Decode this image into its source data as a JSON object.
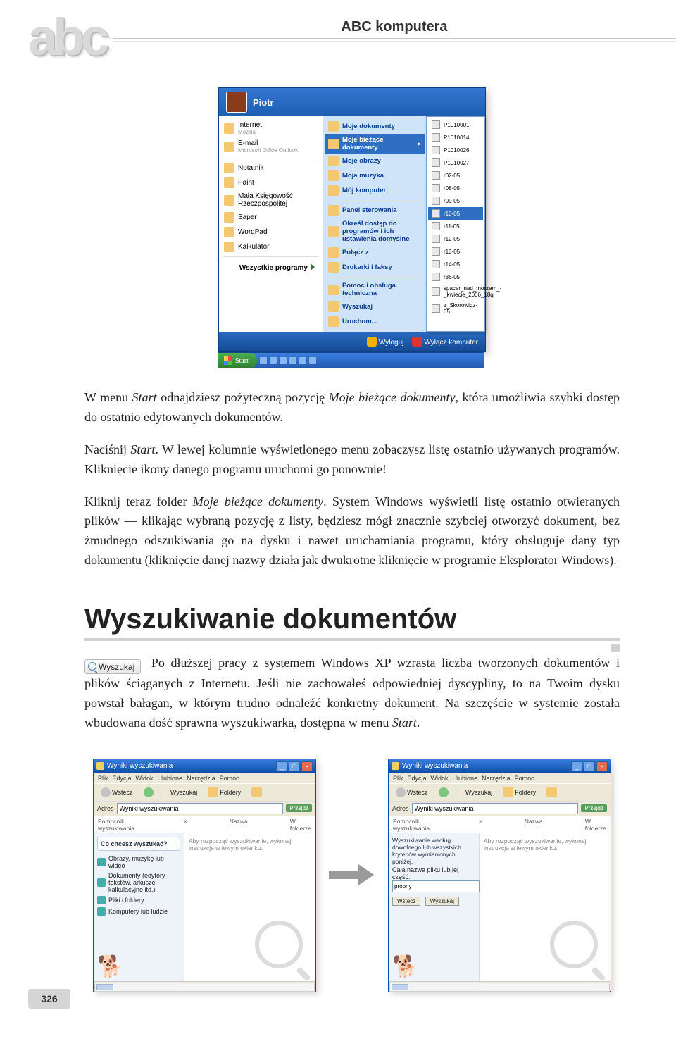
{
  "header": {
    "book_title": "ABC komputera",
    "logo_text": "abc"
  },
  "startmenu": {
    "user": "Piotr",
    "left": [
      {
        "name": "Internet",
        "sub": "Mozilla"
      },
      {
        "name": "E-mail",
        "sub": "Microsoft Office Outlook"
      },
      {
        "name": "Notatnik"
      },
      {
        "name": "Paint"
      },
      {
        "name": "Mała Księgowość Rzeczpospolitej"
      },
      {
        "name": "Saper"
      },
      {
        "name": "WordPad"
      },
      {
        "name": "Kalkulator"
      }
    ],
    "all_programs": "Wszystkie programy",
    "right": [
      "Moje dokumenty",
      "Moje bieżące dokumenty",
      "Moje obrazy",
      "Moja muzyka",
      "Mój komputer",
      "Panel sterowania",
      "Określ dostęp do programów i ich ustawienia domyślne",
      "Połącz z",
      "Drukarki i faksy",
      "Pomoc i obsługa techniczna",
      "Wyszukaj",
      "Uruchom..."
    ],
    "right_highlight_index": 1,
    "submenu": [
      "P1010001",
      "P1010014",
      "P1010026",
      "P1010027",
      "r02-05",
      "r08-05",
      "r09-05",
      "r10-05",
      "r11-05",
      "r12-05",
      "r13-05",
      "r14-05",
      "r36-05",
      "spacer_nad_morzem_-_kwiecie_2006_18q",
      "z_Skorowidz-05"
    ],
    "logoff": "Wyloguj",
    "shutdown": "Wyłącz komputer",
    "start_label": "Start"
  },
  "para1_a": "W menu ",
  "para1_b": "Start",
  "para1_c": " odnajdziesz pożyteczną pozycję ",
  "para1_d": "Moje bieżące dokumenty",
  "para1_e": ", która umożliwia szybki dostęp do ostatnio edytowanych dokumentów.",
  "para2_a": "Naciśnij ",
  "para2_b": "Start",
  "para2_c": ". W lewej kolumnie wyświetlonego menu zobaczysz listę ostatnio używanych programów. Kliknięcie ikony danego programu uruchomi go ponownie!",
  "para3_a": "Kliknij teraz folder ",
  "para3_b": "Moje bieżące dokumenty",
  "para3_c": ". System Windows wyświetli listę ostatnio otwieranych plików — klikając wybraną pozycję z listy, będziesz mógł znacznie szybciej otworzyć dokument, bez żmudnego odszukiwania go na dysku i nawet uruchamiania programu, który obsługuje dany typ dokumentu (kliknięcie danej nazwy działa jak dwukrotne kliknięcie w programie Eksplorator Windows).",
  "section_title": "Wyszukiwanie dokumentów",
  "search_chip": "Wyszukaj",
  "para4_a": " Po dłuższej pracy z systemem Windows XP wzrasta liczba tworzonych dokumentów i plików ściąganych z Internetu. Jeśli nie zachowałeś odpowiedniej dyscypliny, to na Twoim dysku powstał bałagan, w którym trudno odnaleźć konkretny dokument. Na szczęście w systemie została wbudowana dość sprawna wyszukiwarka, dostępna w menu ",
  "para4_b": "Start",
  "para4_c": ".",
  "searchwin": {
    "title": "Wyniki wyszukiwania",
    "menu": [
      "Plik",
      "Edycja",
      "Widok",
      "Ulubione",
      "Narzędzia",
      "Pomoc"
    ],
    "toolbar": {
      "back": "Wstecz",
      "search": "Wyszukaj",
      "folders": "Foldery"
    },
    "addr_label": "Adres",
    "addr_value": "Wyniki wyszukiwania",
    "go": "Przejdź",
    "col_name": "Nazwa",
    "col_folder": "W folderze",
    "helper_line1": "Pomocnik wyszukiwania",
    "helper_hint": "Aby rozpocząć wyszukiwanie, wykonaj instrukcje w lewym okienku.",
    "ask": "Co chcesz wyszukać?",
    "opts": [
      "Obrazy, muzykę lub wideo",
      "Dokumenty (edytory tekstów, arkusze kalkulacyjne itd.)",
      "Pliki i foldery",
      "Komputery lub ludzie"
    ],
    "right_ask": "Wyszukiwanie według dowolnego lub wszystkich kryteriów wymienionych poniżej.",
    "field_label": "Cała nazwa pliku lub jej część:",
    "field_value": "próbny",
    "btn_back": "Wstecz",
    "btn_search": "Wyszukaj"
  },
  "page_number": "326"
}
